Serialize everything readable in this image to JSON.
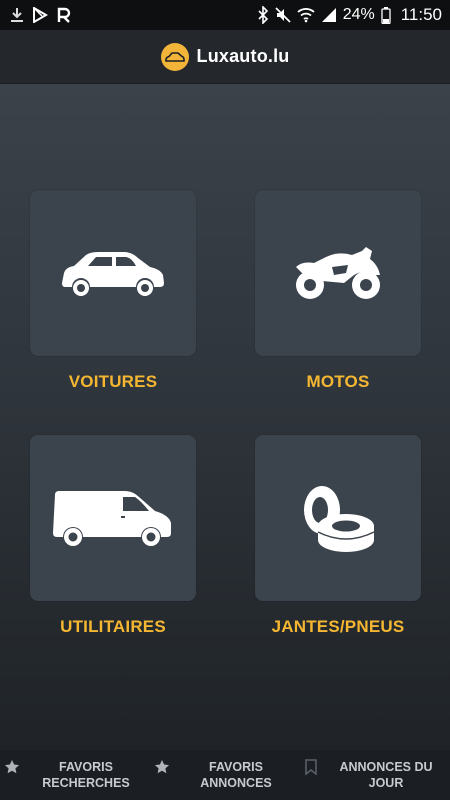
{
  "status_bar": {
    "battery": "24%",
    "time": "11:50",
    "icons_left": [
      "download-icon",
      "play-store-icon",
      "app-r-icon"
    ],
    "icons_right": [
      "bluetooth-icon",
      "mute-icon",
      "wifi-icon",
      "signal-icon",
      "battery-icon"
    ]
  },
  "header": {
    "logo_icon": "car-logo-icon",
    "title": "Luxauto.lu"
  },
  "categories": [
    {
      "label": "VOITURES",
      "icon": "car-icon"
    },
    {
      "label": "MOTOS",
      "icon": "motorcycle-icon"
    },
    {
      "label": "UTILITAIRES",
      "icon": "van-icon"
    },
    {
      "label": "JANTES/PNEUS",
      "icon": "tires-icon"
    }
  ],
  "bottom_nav": [
    {
      "line1": "FAVORIS",
      "line2": "RECHERCHES",
      "icon": "star-icon"
    },
    {
      "line1": "FAVORIS",
      "line2": "ANNONCES",
      "icon": "star-icon"
    },
    {
      "line1": "ANNONCES DU",
      "line2": "JOUR",
      "icon": "bookmark-icon"
    }
  ],
  "colors": {
    "accent": "#f5b731",
    "tile": "#3b434c",
    "header": "#24282d",
    "logo": "#f2b53a"
  }
}
